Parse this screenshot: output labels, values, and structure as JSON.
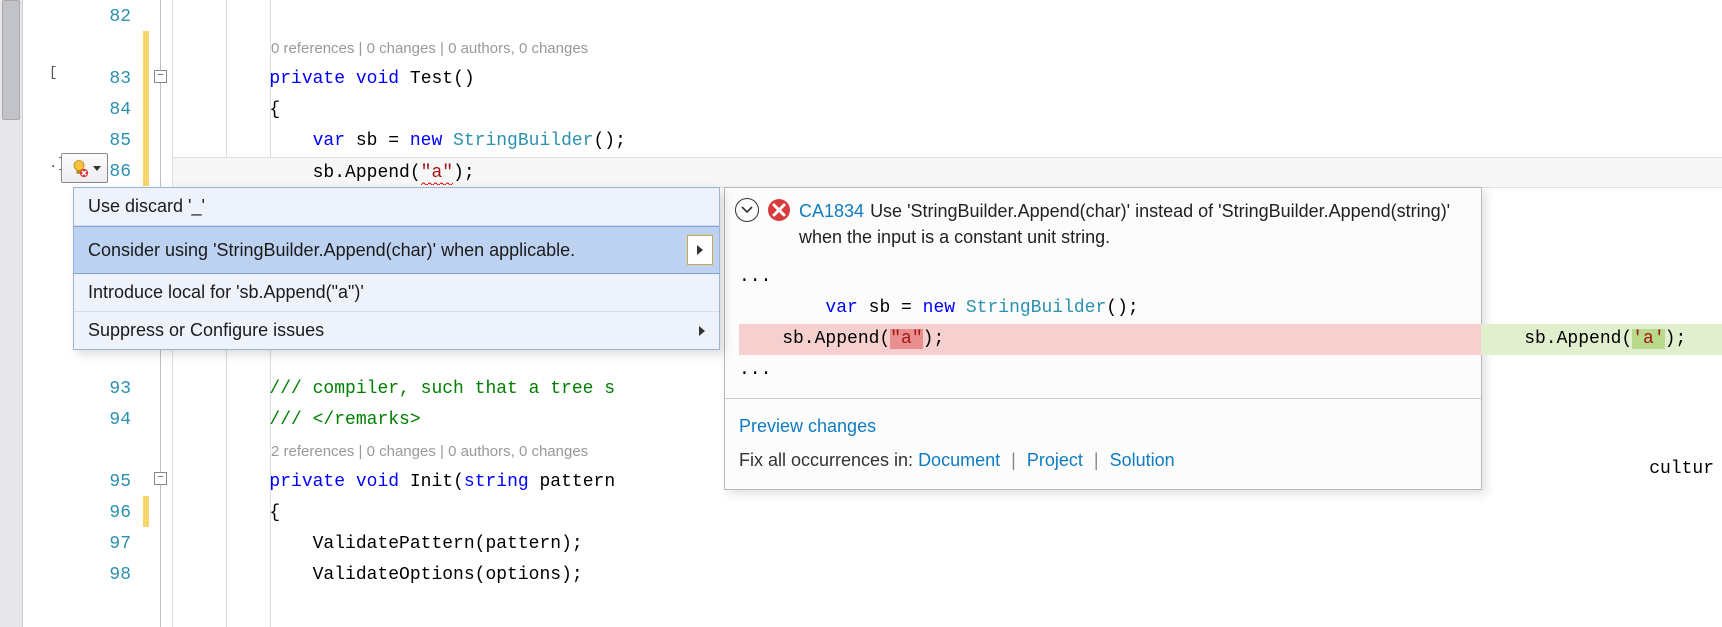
{
  "line_numbers": [
    "82",
    "83",
    "84",
    "85",
    "86",
    "",
    "",
    "",
    "",
    "",
    "93",
    "94",
    "",
    "95",
    "96",
    "97",
    "98"
  ],
  "codelens": {
    "top": "0 references | 0 changes | 0 authors, 0 changes",
    "bottom": "2 references | 0 changes | 0 authors, 0 changes"
  },
  "code": {
    "l83_private": "private",
    "l83_void": "void",
    "l83_name": "Test",
    "l83_paren": "()",
    "l84_brace": "{",
    "l85_var": "var",
    "l85_sb": " sb = ",
    "l85_new": "new",
    "l85_type": " StringBuilder",
    "l85_end": "();",
    "l86_pre": "    sb.Append(",
    "l86_str": "\"a\"",
    "l86_post": ");",
    "l93_cmt": "/// compiler, such that a tree s",
    "l94_cmt": "/// </remarks>",
    "l95_private": "private",
    "l95_void": "void",
    "l95_name": " Init(",
    "l95_string": "string",
    "l95_rest": " pattern",
    "l96_brace": "{",
    "l97_body": "    ValidatePattern(pattern);",
    "l98_body": "    ValidateOptions(options);"
  },
  "floating_right": "cultur",
  "quick_actions": {
    "items": [
      "Use discard '_'",
      "Consider using 'StringBuilder.Append(char)' when applicable.",
      "Introduce local for 'sb.Append(\"a\")'",
      "Suppress or Configure issues"
    ]
  },
  "preview": {
    "rule_id": "CA1834",
    "message": "Use 'StringBuilder.Append(char)' instead of 'StringBuilder.Append(string)' when the input is a constant unit string.",
    "ellipsis": "...",
    "line_var": "    var",
    "line_sb": " sb = ",
    "line_new": "new",
    "line_type": " StringBuilder",
    "line_end": "();",
    "del_pre": "    sb.Append(",
    "del_frag": "\"a\"",
    "del_post": ");",
    "add_pre": "    sb.Append(",
    "add_frag": "'a'",
    "add_post": ");",
    "close_brace": "}",
    "preview_link": "Preview changes",
    "fix_label": "Fix all occurrences in: ",
    "fix_document": "Document",
    "fix_project": "Project",
    "fix_solution": "Solution"
  }
}
